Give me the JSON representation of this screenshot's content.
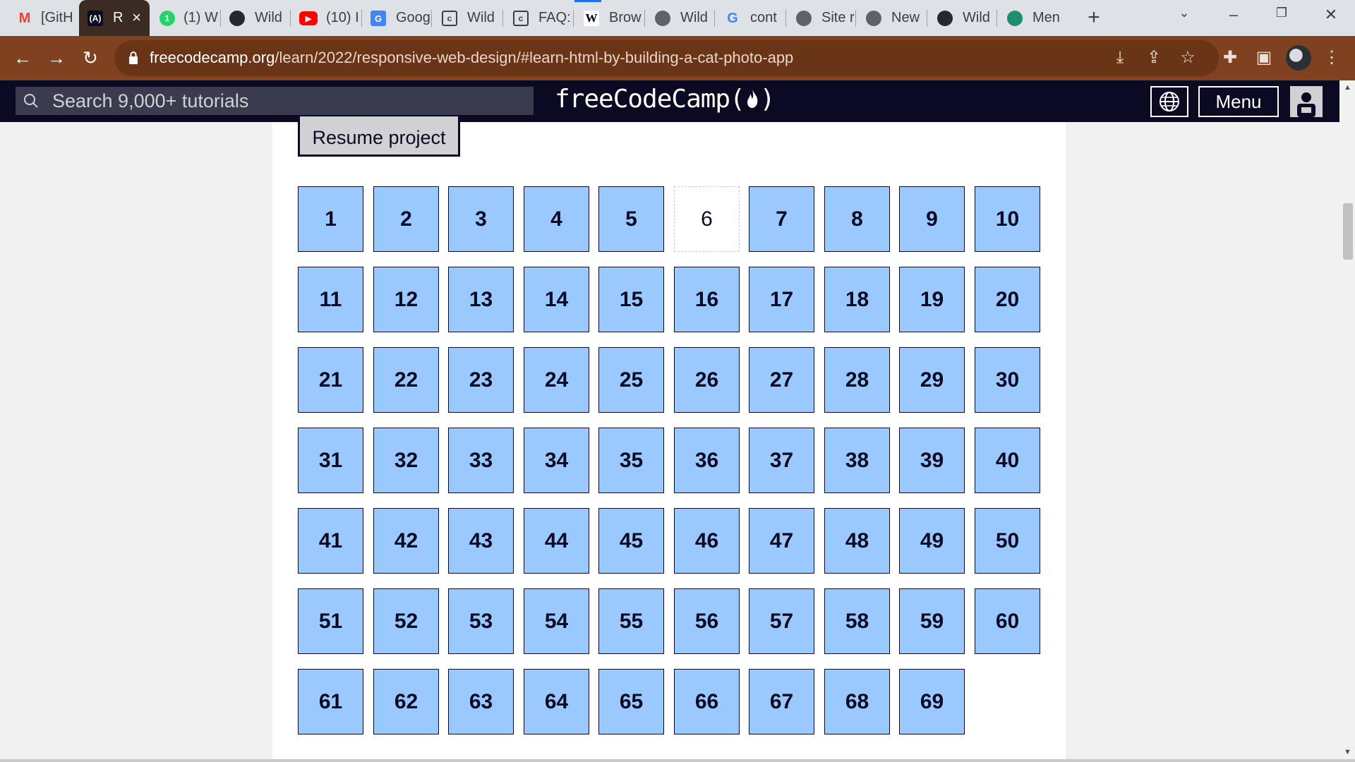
{
  "browser": {
    "tabs": [
      {
        "label": "[GitH",
        "icon": "gmail-icon",
        "active": false
      },
      {
        "label": "R",
        "icon": "freecodecamp-icon",
        "active": true
      },
      {
        "label": "(1) W",
        "icon": "whatsapp-icon",
        "active": false
      },
      {
        "label": "Wild",
        "icon": "github-icon",
        "active": false
      },
      {
        "label": "(10) I",
        "icon": "youtube-icon",
        "active": false
      },
      {
        "label": "Goog",
        "icon": "google-translate-icon",
        "active": false
      },
      {
        "label": "Wild",
        "icon": "document-icon",
        "active": false
      },
      {
        "label": "FAQ:",
        "icon": "document-icon",
        "active": false
      },
      {
        "label": "Brow",
        "icon": "wikipedia-icon",
        "active": false
      },
      {
        "label": "Wild",
        "icon": "globe-icon",
        "active": false
      },
      {
        "label": "cont",
        "icon": "google-icon",
        "active": false
      },
      {
        "label": "Site r",
        "icon": "globe-icon",
        "active": false
      },
      {
        "label": "New",
        "icon": "chrome-icon",
        "active": false
      },
      {
        "label": "Wild",
        "icon": "github-icon",
        "active": false
      },
      {
        "label": "Men",
        "icon": "app-icon",
        "active": false
      }
    ],
    "url_host": "freecodecamp.org",
    "url_path": "/learn/2022/responsive-web-design/#learn-html-by-building-a-cat-photo-app"
  },
  "fcc_nav": {
    "search_placeholder": "Search 9,000+ tutorials",
    "logo_text": "freeCodeCamp(",
    "logo_close": ")",
    "menu_label": "Menu"
  },
  "main": {
    "resume_label": "Resume project",
    "current_step": "6",
    "steps": [
      "1",
      "2",
      "3",
      "4",
      "5",
      "6",
      "7",
      "8",
      "9",
      "10",
      "11",
      "12",
      "13",
      "14",
      "15",
      "16",
      "17",
      "18",
      "19",
      "20",
      "21",
      "22",
      "23",
      "24",
      "25",
      "26",
      "27",
      "28",
      "29",
      "30",
      "31",
      "32",
      "33",
      "34",
      "35",
      "36",
      "37",
      "38",
      "39",
      "40",
      "41",
      "42",
      "43",
      "44",
      "45",
      "46",
      "47",
      "48",
      "49",
      "50",
      "51",
      "52",
      "53",
      "54",
      "55",
      "56",
      "57",
      "58",
      "59",
      "60",
      "61",
      "62",
      "63",
      "64",
      "65",
      "66",
      "67",
      "68",
      "69"
    ]
  },
  "colors": {
    "step_bg": "#99c9ff",
    "nav_bg": "#0a0a23",
    "toolbar_bg": "#7f4120"
  }
}
